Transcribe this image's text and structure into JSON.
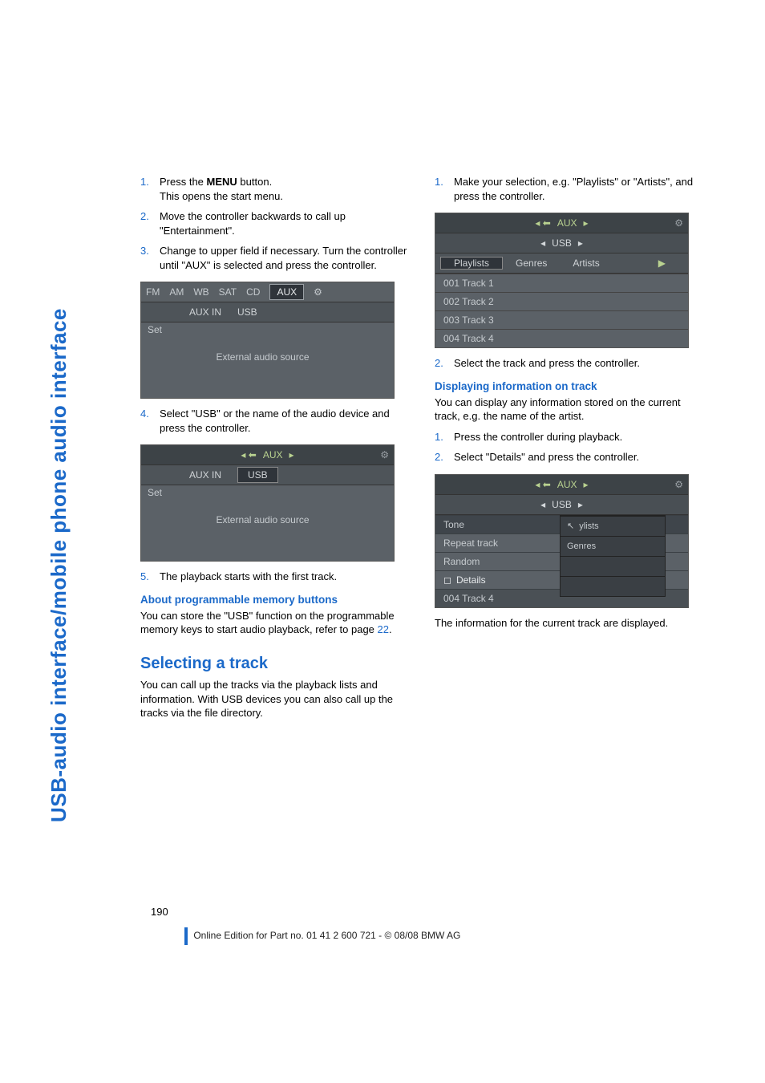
{
  "side_label": "USB-audio interface/mobile phone audio interface",
  "left": {
    "steps_a": [
      {
        "num": "1.",
        "html": "Press the <b>MENU</b> button.",
        "sub": "This opens the start menu."
      },
      {
        "num": "2.",
        "html": "Move the controller backwards to call up \"Entertainment\"."
      },
      {
        "num": "3.",
        "html": "Change to upper field if necessary. Turn the controller until \"AUX\" is selected and press the controller."
      }
    ],
    "screen1": {
      "tabs": [
        "FM",
        "AM",
        "WB",
        "SAT",
        "CD",
        "AUX"
      ],
      "sub": [
        "AUX IN",
        "USB"
      ],
      "set": "Set",
      "source": "External audio source"
    },
    "steps_b": [
      {
        "num": "4.",
        "html": "Select \"USB\" or the name of the audio device and press the controller."
      }
    ],
    "screen2": {
      "top": "AUX",
      "sub": [
        "AUX IN",
        "USB"
      ],
      "set": "Set",
      "source": "External audio source"
    },
    "steps_c": [
      {
        "num": "5.",
        "html": "The playback starts with the first track."
      }
    ],
    "h3_mem": "About programmable memory buttons",
    "mem_body": "You can store the \"USB\" function on the programmable memory keys to start audio playback, refer to page ",
    "mem_page": "22",
    "h2_sel": "Selecting a track",
    "sel_body": "You can call up the tracks via the playback lists and information. With USB devices you can also call up the tracks via the file directory."
  },
  "right": {
    "steps_a": [
      {
        "num": "1.",
        "html": "Make your selection, e.g. \"Playlists\" or \"Artists\", and press the controller."
      }
    ],
    "screen3": {
      "top": "AUX",
      "sub": "USB",
      "tabs": [
        "Playlists",
        "Genres",
        "Artists"
      ],
      "tracks": [
        "001 Track 1",
        "002 Track 2",
        "003 Track 3",
        "004 Track 4"
      ]
    },
    "steps_b": [
      {
        "num": "2.",
        "html": "Select the track and press the controller."
      }
    ],
    "h3_info": "Displaying information on track",
    "info_body": "You can display any information stored on the current track, e.g. the name of the artist.",
    "steps_c": [
      {
        "num": "1.",
        "html": "Press the controller during playback."
      },
      {
        "num": "2.",
        "html": "Select \"Details\" and press the controller."
      }
    ],
    "screen4": {
      "top": "AUX",
      "sub": "USB",
      "menu": [
        "Tone",
        "Repeat track",
        "Random",
        "Details"
      ],
      "overlay": [
        "ylists",
        "Genres"
      ],
      "bottom": "004 Track 4"
    },
    "after": "The information for the current track are displayed."
  },
  "footer": {
    "page": "190",
    "edition": "Online Edition for Part no. 01 41 2 600 721 - © 08/08 BMW AG"
  }
}
